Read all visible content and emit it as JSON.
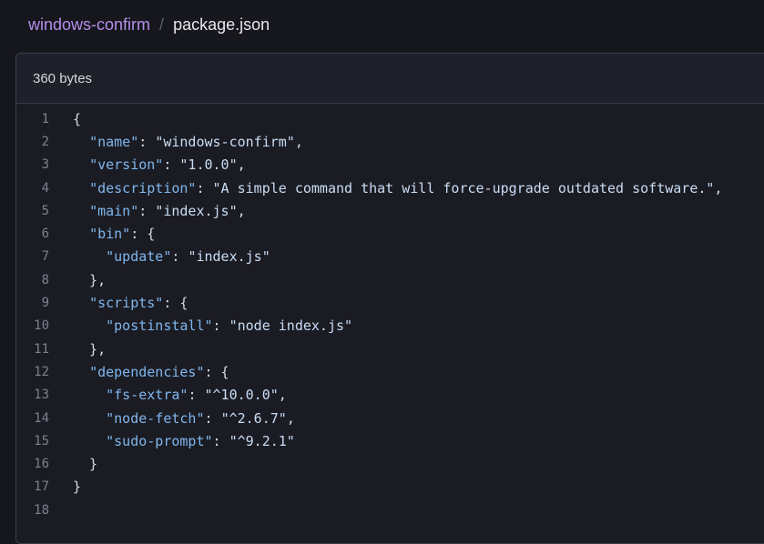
{
  "breadcrumb": {
    "repo": "windows-confirm",
    "separator": "/",
    "file": "package.json"
  },
  "file": {
    "size": "360 bytes"
  },
  "code": {
    "lines": [
      {
        "num": "1",
        "tokens": [
          {
            "t": "p",
            "v": "{"
          }
        ]
      },
      {
        "num": "2",
        "tokens": [
          {
            "t": "p",
            "v": "  "
          },
          {
            "t": "k",
            "v": "\"name\""
          },
          {
            "t": "p",
            "v": ": "
          },
          {
            "t": "s",
            "v": "\"windows-confirm\""
          },
          {
            "t": "p",
            "v": ","
          }
        ]
      },
      {
        "num": "3",
        "tokens": [
          {
            "t": "p",
            "v": "  "
          },
          {
            "t": "k",
            "v": "\"version\""
          },
          {
            "t": "p",
            "v": ": "
          },
          {
            "t": "s",
            "v": "\"1.0.0\""
          },
          {
            "t": "p",
            "v": ","
          }
        ]
      },
      {
        "num": "4",
        "tokens": [
          {
            "t": "p",
            "v": "  "
          },
          {
            "t": "k",
            "v": "\"description\""
          },
          {
            "t": "p",
            "v": ": "
          },
          {
            "t": "s",
            "v": "\"A simple command that will force-upgrade outdated software.\""
          },
          {
            "t": "p",
            "v": ","
          }
        ]
      },
      {
        "num": "5",
        "tokens": [
          {
            "t": "p",
            "v": "  "
          },
          {
            "t": "k",
            "v": "\"main\""
          },
          {
            "t": "p",
            "v": ": "
          },
          {
            "t": "s",
            "v": "\"index.js\""
          },
          {
            "t": "p",
            "v": ","
          }
        ]
      },
      {
        "num": "6",
        "tokens": [
          {
            "t": "p",
            "v": "  "
          },
          {
            "t": "k",
            "v": "\"bin\""
          },
          {
            "t": "p",
            "v": ": {"
          }
        ]
      },
      {
        "num": "7",
        "tokens": [
          {
            "t": "p",
            "v": "    "
          },
          {
            "t": "k",
            "v": "\"update\""
          },
          {
            "t": "p",
            "v": ": "
          },
          {
            "t": "s",
            "v": "\"index.js\""
          }
        ]
      },
      {
        "num": "8",
        "tokens": [
          {
            "t": "p",
            "v": "  },"
          }
        ]
      },
      {
        "num": "9",
        "tokens": [
          {
            "t": "p",
            "v": "  "
          },
          {
            "t": "k",
            "v": "\"scripts\""
          },
          {
            "t": "p",
            "v": ": {"
          }
        ]
      },
      {
        "num": "10",
        "tokens": [
          {
            "t": "p",
            "v": "    "
          },
          {
            "t": "k",
            "v": "\"postinstall\""
          },
          {
            "t": "p",
            "v": ": "
          },
          {
            "t": "s",
            "v": "\"node index.js\""
          }
        ]
      },
      {
        "num": "11",
        "tokens": [
          {
            "t": "p",
            "v": "  },"
          }
        ]
      },
      {
        "num": "12",
        "tokens": [
          {
            "t": "p",
            "v": "  "
          },
          {
            "t": "k",
            "v": "\"dependencies\""
          },
          {
            "t": "p",
            "v": ": {"
          }
        ]
      },
      {
        "num": "13",
        "tokens": [
          {
            "t": "p",
            "v": "    "
          },
          {
            "t": "k",
            "v": "\"fs-extra\""
          },
          {
            "t": "p",
            "v": ": "
          },
          {
            "t": "s",
            "v": "\"^10.0.0\""
          },
          {
            "t": "p",
            "v": ","
          }
        ]
      },
      {
        "num": "14",
        "tokens": [
          {
            "t": "p",
            "v": "    "
          },
          {
            "t": "k",
            "v": "\"node-fetch\""
          },
          {
            "t": "p",
            "v": ": "
          },
          {
            "t": "s",
            "v": "\"^2.6.7\""
          },
          {
            "t": "p",
            "v": ","
          }
        ]
      },
      {
        "num": "15",
        "tokens": [
          {
            "t": "p",
            "v": "    "
          },
          {
            "t": "k",
            "v": "\"sudo-prompt\""
          },
          {
            "t": "p",
            "v": ": "
          },
          {
            "t": "s",
            "v": "\"^9.2.1\""
          }
        ]
      },
      {
        "num": "16",
        "tokens": [
          {
            "t": "p",
            "v": "  }"
          }
        ]
      },
      {
        "num": "17",
        "tokens": [
          {
            "t": "p",
            "v": "}"
          }
        ]
      },
      {
        "num": "18",
        "tokens": []
      }
    ]
  },
  "colors": {
    "background": "#16161d",
    "repo_link": "#b48ee8",
    "json_key": "#7fb6ee",
    "json_string": "#c9dcf5",
    "line_number": "#7d8190"
  }
}
